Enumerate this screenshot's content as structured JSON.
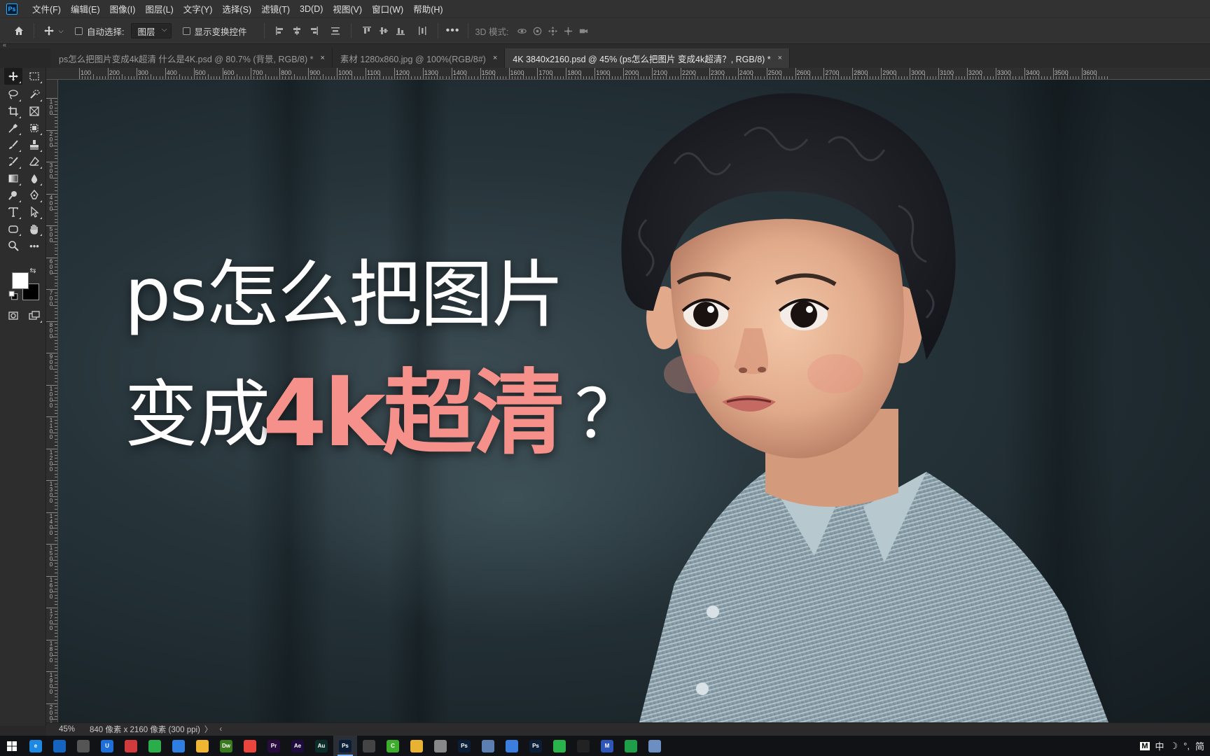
{
  "app": {
    "logo": "Ps"
  },
  "menu": [
    "文件(F)",
    "编辑(E)",
    "图像(I)",
    "图层(L)",
    "文字(Y)",
    "选择(S)",
    "滤镜(T)",
    "3D(D)",
    "视图(V)",
    "窗口(W)",
    "帮助(H)"
  ],
  "options": {
    "auto_select_label": "自动选择:",
    "layer_select_value": "图层",
    "show_transform_label": "显示变换控件",
    "mode_3d_label": "3D 模式:"
  },
  "tabs": [
    {
      "label": "ps怎么把图片变成4k超清 什么是4K.psd @ 80.7% (背景, RGB/8) *",
      "close": "×",
      "active": false
    },
    {
      "label": "素材 1280x860.jpg @ 100%(RGB/8#)",
      "close": "×",
      "active": false
    },
    {
      "label": "4K 3840x2160.psd @ 45% (ps怎么把图片 变成4k超清？, RGB/8) *",
      "close": "×",
      "active": true
    }
  ],
  "ruler_top": [
    "100",
    "200",
    "300",
    "400",
    "500",
    "600",
    "700",
    "800",
    "900",
    "1000",
    "1100",
    "1200",
    "1300",
    "1400",
    "1500",
    "1600",
    "1700",
    "1800",
    "1900",
    "2000",
    "2100",
    "2200",
    "2300",
    "2400",
    "2500",
    "2600",
    "2700",
    "2800",
    "2900",
    "3000",
    "3100",
    "3200",
    "3300",
    "3400",
    "3500",
    "3600"
  ],
  "ruler_left": [
    "1",
    "2",
    "3",
    "4",
    "5",
    "6",
    "7",
    "8",
    "9",
    "10",
    "11",
    "12",
    "13",
    "14",
    "15",
    "16",
    "17",
    "18",
    "19",
    "20"
  ],
  "canvas": {
    "line1": "ps怎么把图片",
    "line2_prefix": "变成",
    "line2_highlight": "4k超清",
    "line2_suffix": "？",
    "highlight_color": "#f5918a"
  },
  "status": {
    "zoom": "45%",
    "doc_info": "840 像素 x 2160 像素 (300 ppi)",
    "arrow": "〉",
    "back_arrow": "‹"
  },
  "taskbar": {
    "apps": [
      {
        "name": "ie",
        "label": "e",
        "color": "#1e88e5"
      },
      {
        "name": "ie-arrow",
        "label": "",
        "color": "#1565c0"
      },
      {
        "name": "wifi",
        "label": "",
        "color": "#555"
      },
      {
        "name": "app-u",
        "label": "U",
        "color": "#1e6fd9"
      },
      {
        "name": "app-red",
        "label": "",
        "color": "#d23b3b"
      },
      {
        "name": "wechat",
        "label": "",
        "color": "#2aae4a"
      },
      {
        "name": "app-blue",
        "label": "",
        "color": "#2f7fe0"
      },
      {
        "name": "app-folder",
        "label": "",
        "color": "#f1b534"
      },
      {
        "name": "dreamweaver",
        "label": "Dw",
        "color": "#3a7a1e"
      },
      {
        "name": "chrome",
        "label": "",
        "color": "#e8453c"
      },
      {
        "name": "premiere",
        "label": "Pr",
        "color": "#2a0b3d"
      },
      {
        "name": "after-effects",
        "label": "Ae",
        "color": "#1f0b3d"
      },
      {
        "name": "audition",
        "label": "Au",
        "color": "#0c2e2b"
      },
      {
        "name": "photoshop-1",
        "label": "Ps",
        "color": "#0a1e38"
      },
      {
        "name": "app-gray",
        "label": "",
        "color": "#444"
      },
      {
        "name": "camtasia",
        "label": "C",
        "color": "#3dae2b"
      },
      {
        "name": "explorer",
        "label": "",
        "color": "#e8b233"
      },
      {
        "name": "app-tools",
        "label": "",
        "color": "#888"
      },
      {
        "name": "photoshop-2",
        "label": "Ps",
        "color": "#0a1e38"
      },
      {
        "name": "app-doc",
        "label": "",
        "color": "#5a7fb0"
      },
      {
        "name": "app-circles",
        "label": "",
        "color": "#3c7de0"
      },
      {
        "name": "photoshop-3",
        "label": "Ps",
        "color": "#0a1e38"
      },
      {
        "name": "app-green",
        "label": "",
        "color": "#2ab34a"
      },
      {
        "name": "capcut",
        "label": "",
        "color": "#222"
      },
      {
        "name": "app-m",
        "label": "M",
        "color": "#2d56b8"
      },
      {
        "name": "app-play",
        "label": "",
        "color": "#1f9e4a"
      },
      {
        "name": "app-notes",
        "label": "",
        "color": "#6a8fc0"
      }
    ],
    "tray": [
      "M",
      "中",
      "☽",
      "°,",
      "简"
    ]
  }
}
